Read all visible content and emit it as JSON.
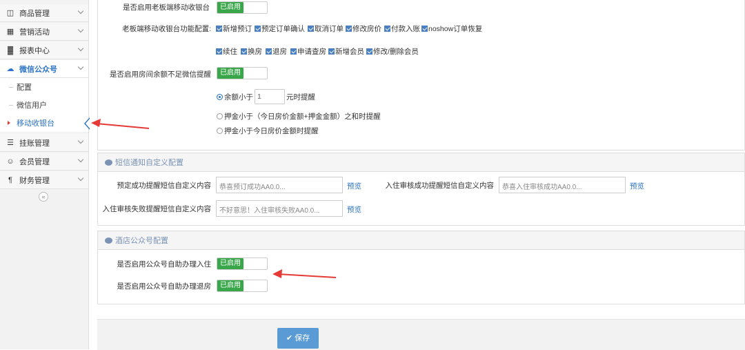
{
  "sidebar": {
    "items": [
      {
        "label": "商品管理",
        "icon": "database-icon"
      },
      {
        "label": "营销活动",
        "icon": "gift-icon"
      },
      {
        "label": "报表中心",
        "icon": "bar-chart-icon"
      },
      {
        "label": "微信公众号",
        "icon": "cloud-icon"
      },
      {
        "label": "挂账管理",
        "icon": "list-icon"
      },
      {
        "label": "会员管理",
        "icon": "users-icon"
      },
      {
        "label": "财务管理",
        "icon": "cutlery-icon"
      }
    ],
    "sub_items": [
      {
        "label": "配置"
      },
      {
        "label": "微信用户"
      },
      {
        "label": "移动收银台"
      }
    ],
    "collapse_label": "«"
  },
  "settings": {
    "mobile_cashier_label": "是否启用老板端移动收银台",
    "mobile_cashier_toggle": "已启用",
    "function_config_label": "老板端移动收银台功能配置:",
    "functions_row1": [
      "新增预订",
      "预定订单确认",
      "取消订单",
      "修改房价",
      "付款入账",
      "noshow订单恢复"
    ],
    "functions_row2": [
      "续住",
      "换房",
      "退房",
      "申请查房",
      "新增会员",
      "修改/删除会员"
    ],
    "balance_remind_label": "是否启用房间余额不足微信提醒",
    "balance_remind_toggle": "已启用",
    "radio_option1_prefix": "余额小于",
    "radio_option1_value": "1",
    "radio_option1_suffix": "元时提醒",
    "radio_option2": "押金小于（今日房价金额+押金金额）之和时提醒",
    "radio_option3": "押金小于今日房价金额时提醒"
  },
  "sms": {
    "title": "短信通知自定义配置",
    "booking_label": "预定成功提醒短信自定义内容",
    "booking_placeholder": "恭喜预订成功AA0.0...",
    "checkin_success_label": "入住审核成功提醒短信自定义内容",
    "checkin_success_placeholder": "恭喜入住审核成功AA0.0...",
    "checkin_fail_label": "入住审核失败提醒短信自定义内容",
    "checkin_fail_placeholder": "不好意思！入住审核失败AA0.0...",
    "preview_label": "预览"
  },
  "hotel_wechat": {
    "title": "酒店公众号配置",
    "self_checkin_label": "是否启用公众号自助办理入住",
    "self_checkin_toggle": "已启用",
    "self_checkout_label": "是否启用公众号自助办理退房",
    "self_checkout_toggle": "已启用"
  },
  "footer": {
    "save_label": "保存"
  },
  "colors": {
    "accent": "#2b73c7",
    "toggle_on": "#3aa64a",
    "save_button": "#5b9bd5",
    "arrow": "#e53935"
  }
}
